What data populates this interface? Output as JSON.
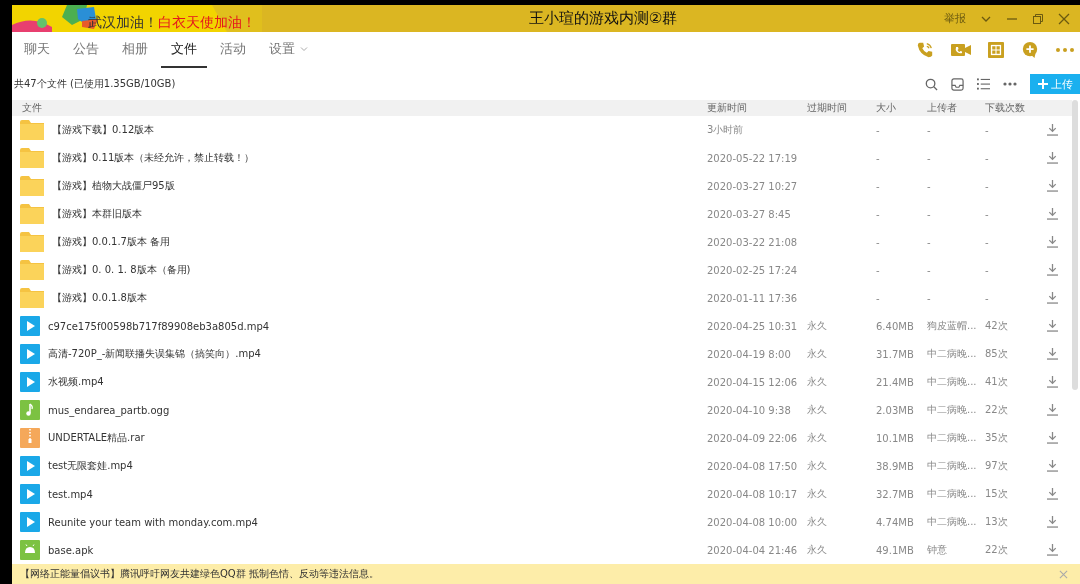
{
  "window": {
    "title": "王小瑄的游戏内测②群",
    "banner": [
      "武汉加油！",
      "白衣天使加油！"
    ],
    "report": "举报"
  },
  "tabs": [
    {
      "label": "聊天",
      "selected": false
    },
    {
      "label": "公告",
      "selected": false
    },
    {
      "label": "相册",
      "selected": false
    },
    {
      "label": "文件",
      "selected": true
    },
    {
      "label": "活动",
      "selected": false
    },
    {
      "label": "设置",
      "selected": false,
      "dropdown": true
    }
  ],
  "summary": "共47个文件 (已使用1.35GB/10GB)",
  "upload_button": "上传",
  "table": {
    "columns": [
      "文件",
      "更新时间",
      "过期时间",
      "大小",
      "上传者",
      "下载次数"
    ],
    "rows": [
      {
        "kind": "folder",
        "name": "【游戏下载】0.12版本",
        "updated": "3小时前",
        "expires": "",
        "size": "-",
        "uploader": "-",
        "downloads": "-"
      },
      {
        "kind": "folder",
        "name": "【游戏】0.11版本（未经允许，禁止转载！）",
        "updated": "2020-05-22 17:19",
        "expires": "",
        "size": "-",
        "uploader": "-",
        "downloads": "-"
      },
      {
        "kind": "folder",
        "name": "【游戏】植物大战僵尸95版",
        "updated": "2020-03-27 10:27",
        "expires": "",
        "size": "-",
        "uploader": "-",
        "downloads": "-"
      },
      {
        "kind": "folder",
        "name": "【游戏】本群旧版本",
        "updated": "2020-03-27 8:45",
        "expires": "",
        "size": "-",
        "uploader": "-",
        "downloads": "-"
      },
      {
        "kind": "folder",
        "name": "【游戏】0.0.1.7版本 备用",
        "updated": "2020-03-22 21:08",
        "expires": "",
        "size": "-",
        "uploader": "-",
        "downloads": "-"
      },
      {
        "kind": "folder",
        "name": "【游戏】0. 0. 1. 8版本（备用)",
        "updated": "2020-02-25 17:24",
        "expires": "",
        "size": "-",
        "uploader": "-",
        "downloads": "-"
      },
      {
        "kind": "folder",
        "name": "【游戏】0.0.1.8版本",
        "updated": "2020-01-11 17:36",
        "expires": "",
        "size": "-",
        "uploader": "-",
        "downloads": "-"
      },
      {
        "kind": "video",
        "name": "c97ce175f00598b717f89908eb3a805d.mp4",
        "updated": "2020-04-25 10:31",
        "expires": "永久",
        "size": "6.40MB",
        "uploader": "狗皮蓝帽...",
        "downloads": "42次"
      },
      {
        "kind": "video",
        "name": "高清-720P_-新闻联播失误集锦（搞笑向）.mp4",
        "updated": "2020-04-19 8:00",
        "expires": "永久",
        "size": "31.7MB",
        "uploader": "中二病晚...",
        "downloads": "85次"
      },
      {
        "kind": "video",
        "name": "水视频.mp4",
        "updated": "2020-04-15 12:06",
        "expires": "永久",
        "size": "21.4MB",
        "uploader": "中二病晚...",
        "downloads": "41次"
      },
      {
        "kind": "audio",
        "name": "mus_endarea_partb.ogg",
        "updated": "2020-04-10 9:38",
        "expires": "永久",
        "size": "2.03MB",
        "uploader": "中二病晚...",
        "downloads": "22次"
      },
      {
        "kind": "archive",
        "name": "UNDERTALE精品.rar",
        "updated": "2020-04-09 22:06",
        "expires": "永久",
        "size": "10.1MB",
        "uploader": "中二病晚...",
        "downloads": "35次"
      },
      {
        "kind": "video",
        "name": "test无限套娃.mp4",
        "updated": "2020-04-08 17:50",
        "expires": "永久",
        "size": "38.9MB",
        "uploader": "中二病晚...",
        "downloads": "97次"
      },
      {
        "kind": "video",
        "name": "test.mp4",
        "updated": "2020-04-08 10:17",
        "expires": "永久",
        "size": "32.7MB",
        "uploader": "中二病晚...",
        "downloads": "15次"
      },
      {
        "kind": "video",
        "name": "Reunite your team with monday.com.mp4",
        "updated": "2020-04-08 10:00",
        "expires": "永久",
        "size": "4.74MB",
        "uploader": "中二病晚...",
        "downloads": "13次"
      },
      {
        "kind": "apk",
        "name": "base.apk",
        "updated": "2020-04-04 21:46",
        "expires": "永久",
        "size": "49.1MB",
        "uploader": "钟意",
        "downloads": "22次"
      }
    ]
  },
  "notice": "【网络正能量倡议书】腾讯呼吁网友共建绿色QQ群 抵制色情、反动等违法信息。"
}
